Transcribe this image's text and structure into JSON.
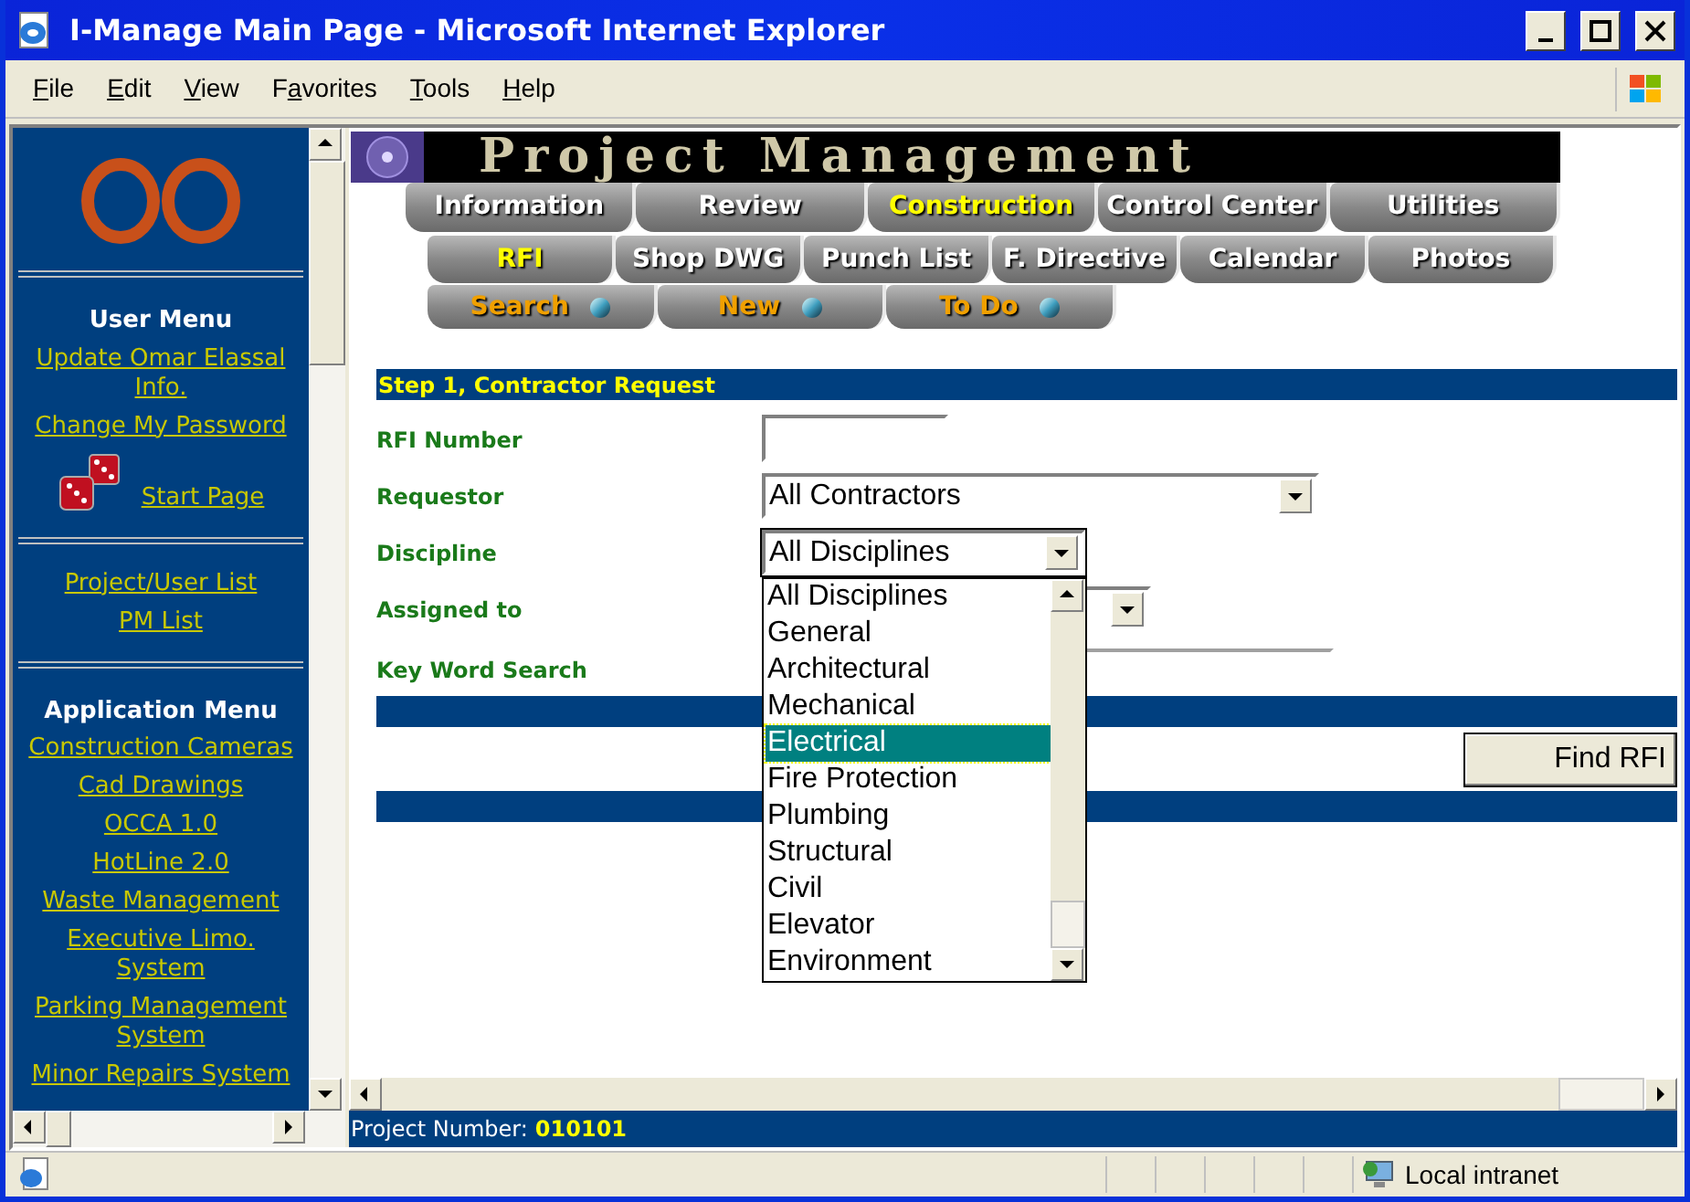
{
  "window": {
    "title": "I-Manage Main Page - Microsoft Internet Explorer"
  },
  "menu_bar": [
    {
      "access_key": "F",
      "rest": "ile"
    },
    {
      "access_key": "E",
      "rest": "dit"
    },
    {
      "access_key": "V",
      "rest": "iew"
    },
    {
      "lead": "F",
      "access_key": "a",
      "rest": "vorites"
    },
    {
      "access_key": "T",
      "rest": "ools"
    },
    {
      "access_key": "H",
      "rest": "elp"
    }
  ],
  "sidebar": {
    "sections": [
      {
        "title": "User Menu",
        "links": [
          {
            "label": "Update Omar Elassal Info.",
            "kind": "text"
          },
          {
            "label": "Change My Password",
            "kind": "text"
          },
          {
            "label": "Start Page",
            "kind": "dice"
          }
        ]
      },
      {
        "links": [
          {
            "label": "Project/User List",
            "kind": "text"
          },
          {
            "label": "PM List",
            "kind": "text"
          }
        ]
      },
      {
        "title": "Application Menu",
        "links": [
          {
            "label": "Construction Cameras",
            "kind": "text"
          },
          {
            "label": "Cad Drawings",
            "kind": "text"
          },
          {
            "label": "OCCA 1.0",
            "kind": "text"
          },
          {
            "label": "HotLine 2.0",
            "kind": "text"
          },
          {
            "label": "Waste Management",
            "kind": "text"
          },
          {
            "label": "Executive Limo. System",
            "kind": "text"
          },
          {
            "label": "Parking Management System",
            "kind": "text"
          },
          {
            "label": "Minor Repairs System",
            "kind": "text"
          }
        ]
      }
    ]
  },
  "banner": {
    "title": "Project Management"
  },
  "nav_main": [
    {
      "label": "Information",
      "selected": false
    },
    {
      "label": "Review",
      "selected": false
    },
    {
      "label": "Construction",
      "selected": true
    },
    {
      "label": "Control Center",
      "selected": false
    },
    {
      "label": "Utilities",
      "selected": false
    }
  ],
  "nav_sub": [
    {
      "label": "RFI",
      "selected": true
    },
    {
      "label": "Shop DWG",
      "selected": false
    },
    {
      "label": "Punch List",
      "selected": false
    },
    {
      "label": "F. Directive",
      "selected": false
    },
    {
      "label": "Calendar",
      "selected": false
    },
    {
      "label": "Photos",
      "selected": false
    }
  ],
  "nav_actions": [
    {
      "label": "Search"
    },
    {
      "label": "New"
    },
    {
      "label": "To Do"
    }
  ],
  "form": {
    "header": "Step 1, Contractor Request",
    "fields": [
      {
        "label": "RFI Number",
        "kind": "text"
      },
      {
        "label": "Requestor",
        "kind": "select",
        "value": "All Contractors"
      },
      {
        "label": "Discipline",
        "kind": "select",
        "value": "All Disciplines",
        "expanded": true
      },
      {
        "label": "Assigned to",
        "kind": "select",
        "expanded": false
      },
      {
        "label": "Key Word Search",
        "kind": "text"
      }
    ],
    "options": [
      {
        "label": "All Disciplines",
        "selected": false
      },
      {
        "label": "General",
        "selected": false
      },
      {
        "label": "Architectural",
        "selected": false
      },
      {
        "label": "Mechanical",
        "selected": false
      },
      {
        "label": "Electrical",
        "selected": true
      },
      {
        "label": "Fire Protection",
        "selected": false
      },
      {
        "label": "Plumbing",
        "selected": false
      },
      {
        "label": "Structural",
        "selected": false
      },
      {
        "label": "Civil",
        "selected": false
      },
      {
        "label": "Elevator",
        "selected": false
      },
      {
        "label": "Environment",
        "selected": false
      }
    ],
    "button": "Find RFI"
  },
  "frame_status": {
    "label": "Project Number:",
    "value": "010101"
  },
  "status_bar": {
    "zone": "Local intranet"
  }
}
